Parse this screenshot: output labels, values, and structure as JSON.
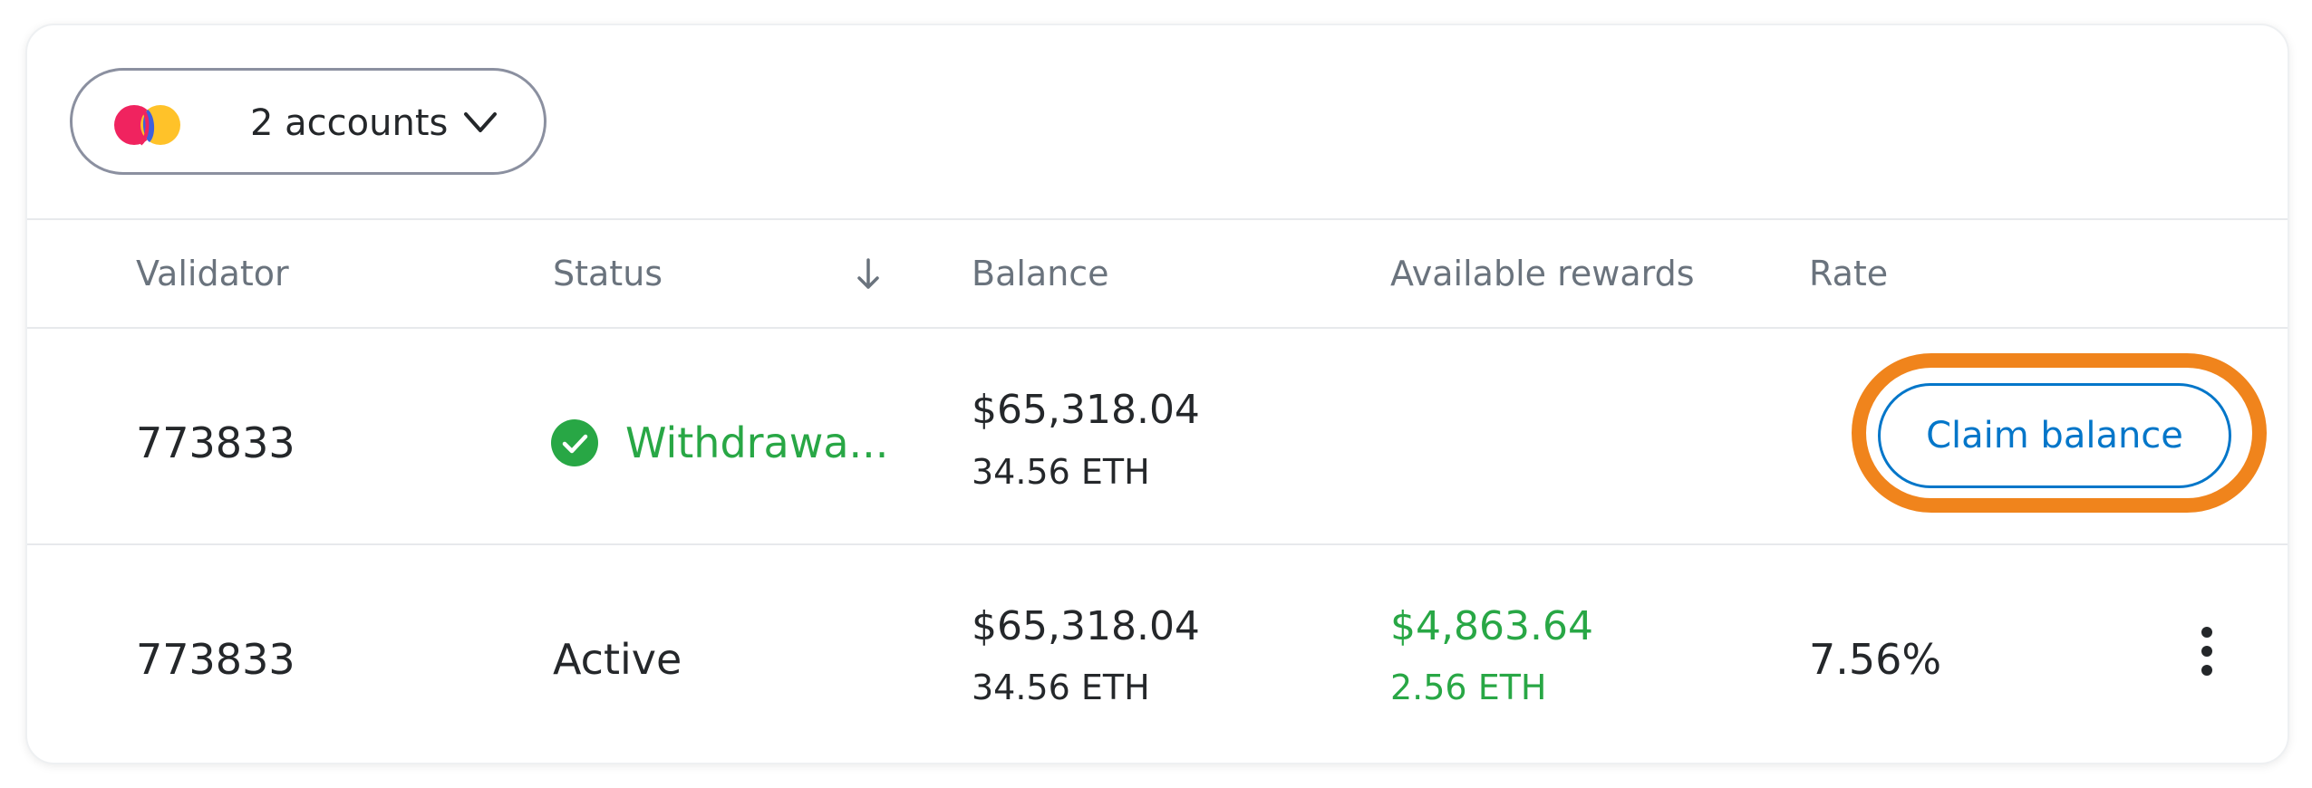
{
  "accounts": {
    "label": "2 accounts",
    "avatar_colors": [
      "#f0235f",
      "#2a55f0",
      "#ffc229"
    ]
  },
  "table": {
    "headers": [
      "Validator",
      "Status",
      "Balance",
      "Available rewards",
      "Rate"
    ],
    "rows": [
      {
        "validator": "773833",
        "status": "Withdrawa...",
        "balance_usd": "$65,318.04",
        "balance_eth": "34.56 ETH",
        "rewards_usd": "",
        "rewards_eth": "",
        "rate": "",
        "action": "Claim balance"
      },
      {
        "validator": "773833",
        "status": "Active",
        "balance_usd": "$65,318.04",
        "balance_eth": "34.56 ETH",
        "rewards_usd": "$4,863.64",
        "rewards_eth": "2.56 ETH",
        "rate": "7.56%"
      }
    ]
  },
  "colors": {
    "success": "#28a745",
    "primary": "#0376c9",
    "highlight": "#f0841c",
    "muted": "#6a737d"
  },
  "icons": {
    "accounts": "overlapping-avatars-icon",
    "dropdown": "chevron-down-icon",
    "sort": "arrow-down-icon",
    "status_ok": "check-circle-icon",
    "menu": "more-vertical-icon"
  }
}
